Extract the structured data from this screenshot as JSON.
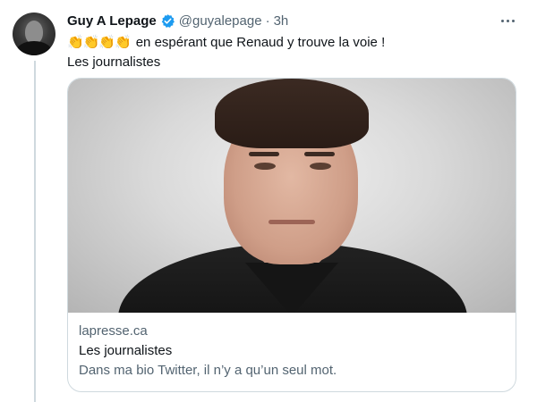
{
  "tweet": {
    "author": {
      "display_name": "Guy A Lepage",
      "handle": "@guyalepage",
      "verified": true,
      "avatar_icon": "user-avatar"
    },
    "separator": "·",
    "timestamp": "3h",
    "more_icon": "more-horizontal-icon",
    "emojis": "👏👏👏👏",
    "text_line1": "en espérant que Renaud y trouve la voie !",
    "text_line2": "Les journalistes",
    "card": {
      "domain": "lapresse.ca",
      "title": "Les journalistes",
      "description": "Dans ma bio Twitter, il n’y a qu’un seul mot."
    }
  },
  "colors": {
    "verified_badge": "#1d9bf0",
    "primary_text": "#0f1419",
    "secondary_text": "#536471",
    "border": "#cfd9de"
  }
}
